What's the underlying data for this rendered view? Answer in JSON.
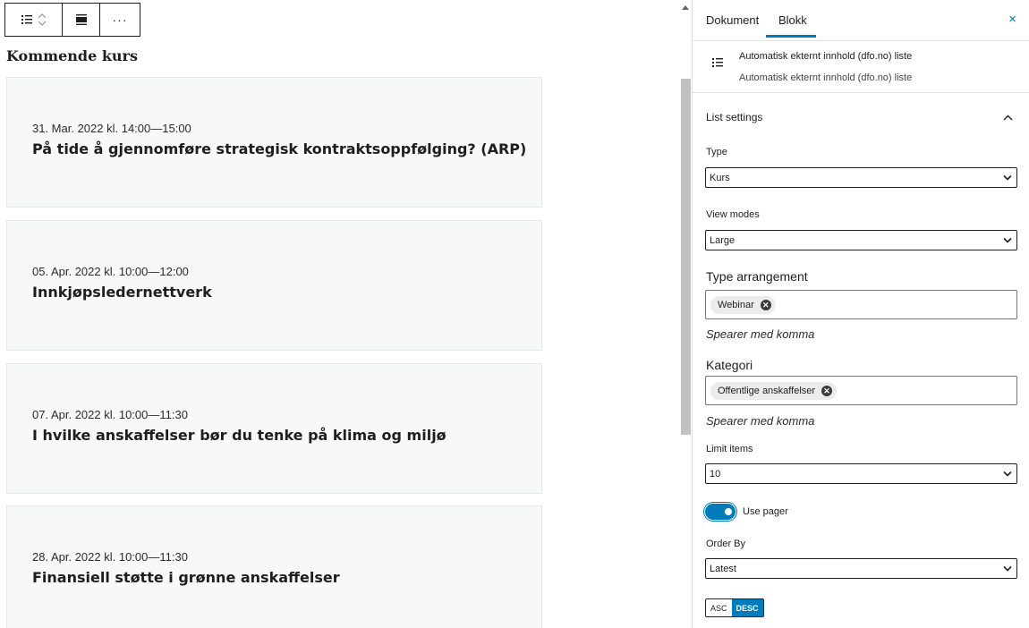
{
  "toolbar": {
    "list_icon": "list-view-icon",
    "align_icon": "align-center-icon",
    "more_label": "···"
  },
  "content": {
    "heading": "Kommende kurs",
    "courses": [
      {
        "date": "31. Mar. 2022 kl. 14:00—15:00",
        "title": "På tide å gjennomføre strategisk kontraktsoppfølging? (ARP)"
      },
      {
        "date": "05. Apr. 2022 kl. 10:00—12:00",
        "title": "Innkjøpsledernettverk"
      },
      {
        "date": "07. Apr. 2022 kl. 10:00—11:30",
        "title": "I hvilke anskaffelser bør du tenke på klima og miljø"
      },
      {
        "date": "28. Apr. 2022 kl. 10:00—11:30",
        "title": "Finansiell støtte i grønne anskaffelser"
      }
    ]
  },
  "sidebar": {
    "tabs": [
      "Dokument",
      "Blokk"
    ],
    "active_tab": "Blokk",
    "close_label": "×",
    "block": {
      "title": "Automatisk ekternt innhold (dfo.no) liste",
      "description": "Automatisk ekternt innhold (dfo.no) liste"
    },
    "panel": {
      "title": "List settings",
      "type_label": "Type",
      "type_value": "Kurs",
      "view_modes_label": "View modes",
      "view_modes_value": "Large",
      "type_arrangement_label": "Type arrangement",
      "type_arrangement_token": "Webinar",
      "type_arrangement_hint": "Spearer med komma",
      "kategori_label": "Kategori",
      "kategori_token": "Offentlige anskaffelser",
      "kategori_hint": "Spearer med komma",
      "limit_label": "Limit items",
      "limit_value": "10",
      "use_pager_label": "Use pager",
      "use_pager_on": true,
      "order_by_label": "Order By",
      "order_by_value": "Latest",
      "asc_label": "ASC",
      "desc_label": "DESC",
      "active_order": "DESC"
    }
  },
  "colors": {
    "accent": "#007cba",
    "card_bg": "#f7f9f8"
  }
}
